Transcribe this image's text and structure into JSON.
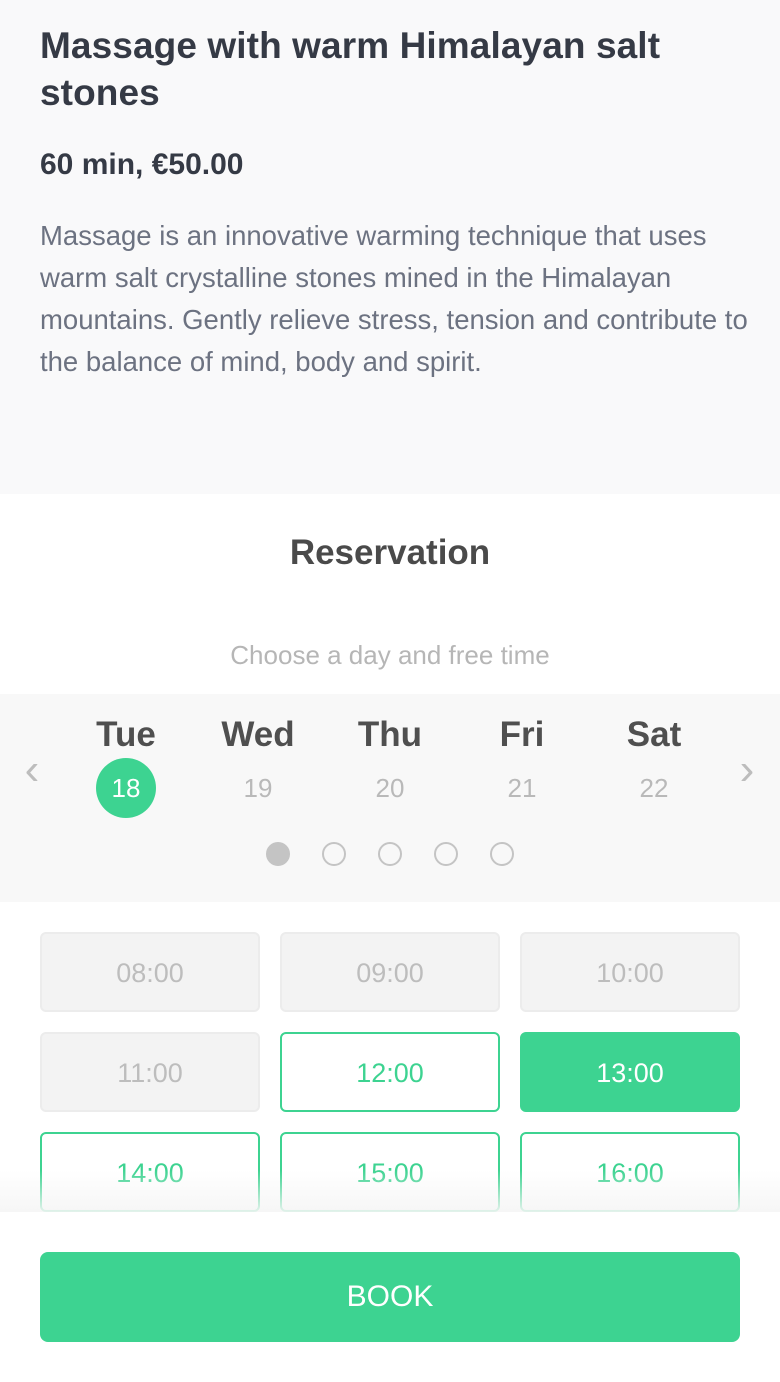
{
  "service": {
    "title": "Massage with warm Himalayan salt stones",
    "duration_price": "60 min, €50.00",
    "description": "Massage is an innovative warming technique that uses warm salt crystalline stones mined in the Himalayan mountains. Gently relieve stress, tension and contribute to the balance of mind, body and spirit."
  },
  "reservation": {
    "title": "Reservation",
    "subtitle": "Choose a day and free time",
    "prev_icon": "‹",
    "next_icon": "›",
    "days": [
      {
        "name": "Tue",
        "date": "18",
        "selected": true
      },
      {
        "name": "Wed",
        "date": "19",
        "selected": false
      },
      {
        "name": "Thu",
        "date": "20",
        "selected": false
      },
      {
        "name": "Fri",
        "date": "21",
        "selected": false
      },
      {
        "name": "Sat",
        "date": "22",
        "selected": false
      }
    ],
    "pages": {
      "total": 5,
      "current": 1
    },
    "time_slots": [
      {
        "time": "08:00",
        "state": "unavailable"
      },
      {
        "time": "09:00",
        "state": "unavailable"
      },
      {
        "time": "10:00",
        "state": "unavailable"
      },
      {
        "time": "11:00",
        "state": "unavailable"
      },
      {
        "time": "12:00",
        "state": "available"
      },
      {
        "time": "13:00",
        "state": "selected"
      },
      {
        "time": "14:00",
        "state": "available"
      },
      {
        "time": "15:00",
        "state": "available"
      },
      {
        "time": "16:00",
        "state": "available"
      }
    ]
  },
  "footer": {
    "book_label": "BOOK"
  },
  "colors": {
    "accent": "#3dd391",
    "title_text": "#353a45",
    "muted": "#bdbdbd"
  }
}
